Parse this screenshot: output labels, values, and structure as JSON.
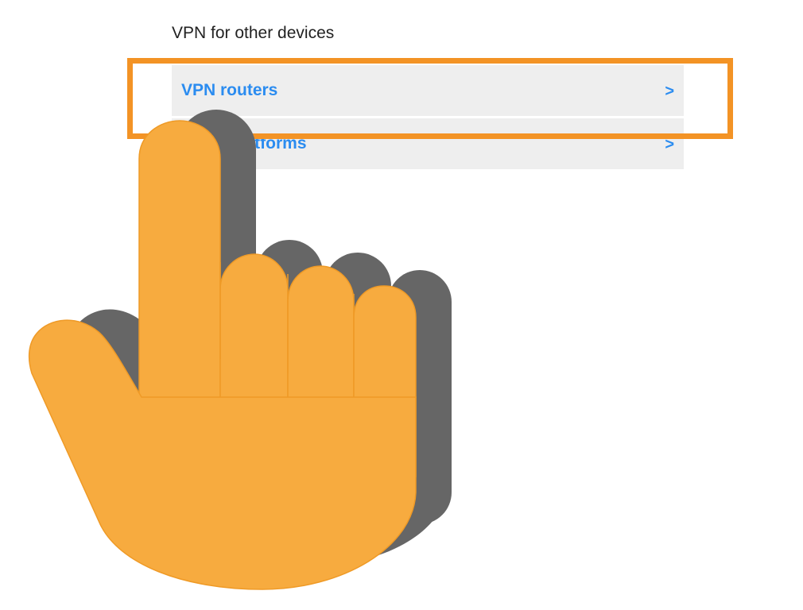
{
  "section": {
    "heading": "VPN for other devices"
  },
  "menu": {
    "items": [
      {
        "label": "VPN routers",
        "chevron": ">"
      },
      {
        "label": "Other platforms",
        "chevron": ">"
      }
    ]
  },
  "overlay": {
    "highlight_color": "#f39325",
    "hand_color": "#f7ab3f",
    "hand_shadow_color": "#666666",
    "icon": "pointing-hand-icon"
  },
  "colors": {
    "link": "#2b8cf0",
    "row_background": "#eeeeee"
  }
}
